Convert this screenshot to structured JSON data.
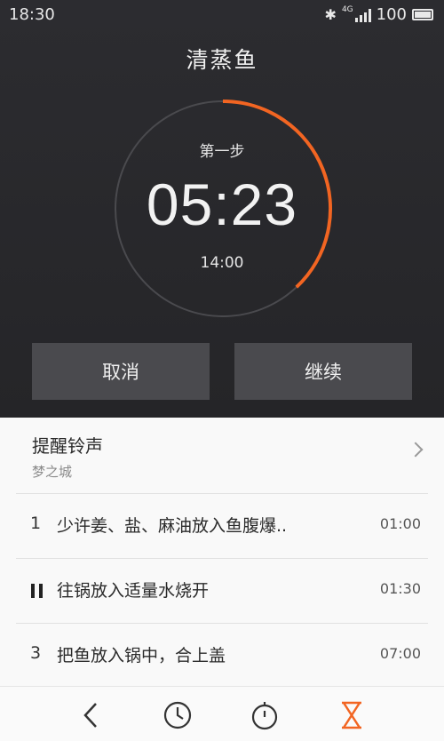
{
  "status": {
    "time": "18:30",
    "network": "4G",
    "battery": "100"
  },
  "timer": {
    "recipe_title": "清蒸鱼",
    "step_label": "第一步",
    "countdown": "05:23",
    "target_time": "14:00",
    "progress_fraction": 0.38
  },
  "buttons": {
    "cancel": "取消",
    "continue": "继续"
  },
  "ringtone": {
    "title": "提醒铃声",
    "value": "梦之城"
  },
  "steps": [
    {
      "marker": "1",
      "text": "少许姜、盐、麻油放入鱼腹爆..",
      "duration": "01:00",
      "state": "done"
    },
    {
      "marker": "",
      "text": "往锅放入适量水烧开",
      "duration": "01:30",
      "state": "active"
    },
    {
      "marker": "3",
      "text": "把鱼放入锅中，合上盖",
      "duration": "07:00",
      "state": "pending"
    }
  ],
  "colors": {
    "accent": "#f26522",
    "background": "#2b2b2e",
    "sheet": "#f9f9f9"
  },
  "nav": {
    "icons": [
      "back-icon",
      "clock-icon",
      "stopwatch-icon",
      "timer-icon"
    ],
    "active": "timer-icon"
  }
}
